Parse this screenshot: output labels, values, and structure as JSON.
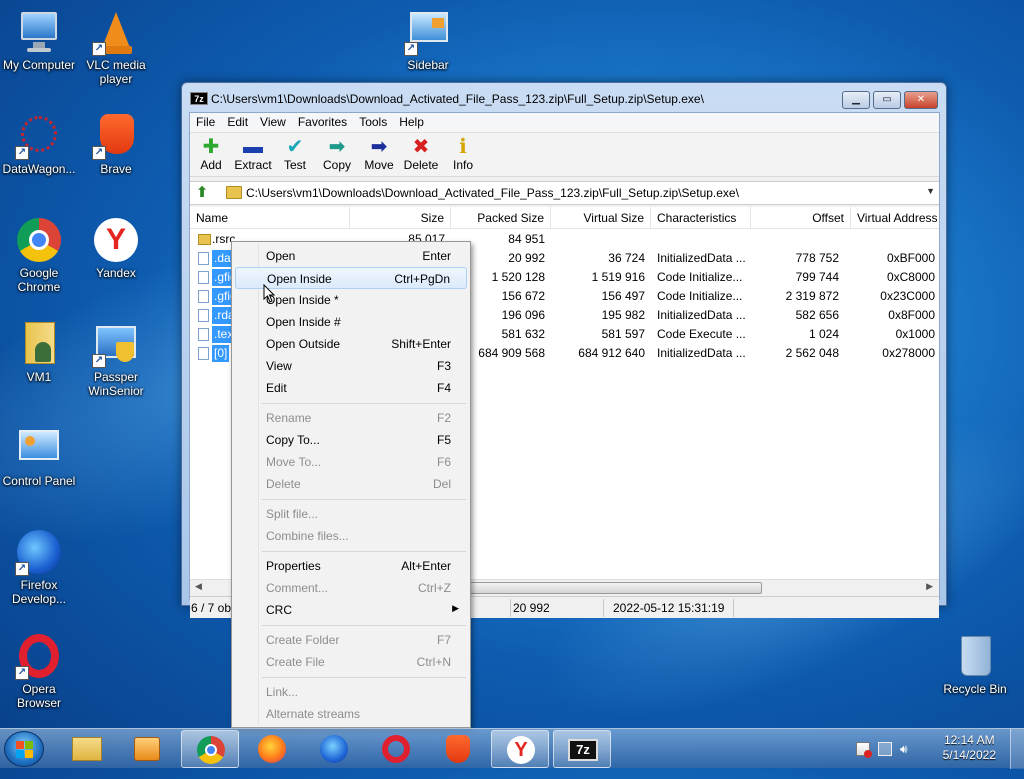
{
  "desktop": {
    "icons": [
      {
        "label": "My Computer"
      },
      {
        "label": "VLC media player"
      },
      {
        "label": "Sidebar"
      },
      {
        "label": "DataWagon..."
      },
      {
        "label": "Brave"
      },
      {
        "label": "Google Chrome"
      },
      {
        "label": "Yandex"
      },
      {
        "label": "VM1"
      },
      {
        "label": "Passper WinSenior"
      },
      {
        "label": "Control Panel"
      },
      {
        "label": "Firefox Develop..."
      },
      {
        "label": "Opera Browser"
      },
      {
        "label": "Recycle Bin"
      }
    ]
  },
  "window": {
    "title": "C:\\Users\\vm1\\Downloads\\Download_Activated_File_Pass_123.zip\\Full_Setup.zip\\Setup.exe\\",
    "app_icon": "7z",
    "menu": [
      "File",
      "Edit",
      "View",
      "Favorites",
      "Tools",
      "Help"
    ],
    "toolbar": [
      {
        "label": "Add",
        "icon": "plus-icon",
        "color": "#2ea82e"
      },
      {
        "label": "Extract",
        "icon": "minus-icon",
        "color": "#1c3fb0"
      },
      {
        "label": "Test",
        "icon": "check-icon",
        "color": "#1aa7b8"
      },
      {
        "label": "Copy",
        "icon": "arrow-right-icon",
        "color": "#1d9a8a"
      },
      {
        "label": "Move",
        "icon": "arrow-right-icon",
        "color": "#1c2f9a"
      },
      {
        "label": "Delete",
        "icon": "x-icon",
        "color": "#d61f1f"
      },
      {
        "label": "Info",
        "icon": "info-icon",
        "color": "#d4a400"
      }
    ],
    "address": "C:\\Users\\vm1\\Downloads\\Download_Activated_File_Pass_123.zip\\Full_Setup.zip\\Setup.exe\\",
    "columns": [
      "Name",
      "Size",
      "Packed Size",
      "Virtual Size",
      "Characteristics",
      "Offset",
      "Virtual Address"
    ],
    "rows": [
      {
        "name": ".rsrc",
        "size": "85 017",
        "packed": "84 951",
        "vsize": "",
        "chars": "",
        "offset": "",
        "vaddr": "",
        "type": "folder",
        "selected": false
      },
      {
        "name": ".data",
        "size": "",
        "packed": "20 992",
        "vsize": "36 724",
        "chars": "InitializedData ...",
        "offset": "778 752",
        "vaddr": "0xBF000",
        "type": "file",
        "selected": true
      },
      {
        "name": ".gfids",
        "size": "",
        "packed": "1 520 128",
        "vsize": "1 519 916",
        "chars": "Code Initialize...",
        "offset": "799 744",
        "vaddr": "0xC8000",
        "type": "file",
        "selected": true
      },
      {
        "name": ".gfids",
        "size": "",
        "packed": "156 672",
        "vsize": "156 497",
        "chars": "Code Initialize...",
        "offset": "2 319 872",
        "vaddr": "0x23C000",
        "type": "file",
        "selected": true
      },
      {
        "name": ".rdata",
        "size": "",
        "packed": "196 096",
        "vsize": "195 982",
        "chars": "InitializedData ...",
        "offset": "582 656",
        "vaddr": "0x8F000",
        "type": "file",
        "selected": true
      },
      {
        "name": ".text",
        "size": "",
        "packed": "581 632",
        "vsize": "581 597",
        "chars": "Code Execute ...",
        "offset": "1 024",
        "vaddr": "0x1000",
        "type": "file",
        "selected": true
      },
      {
        "name": "[0]",
        "size": "",
        "packed": "684 909 568",
        "vsize": "684 912 640",
        "chars": "InitializedData ...",
        "offset": "2 562 048",
        "vaddr": "0x278000",
        "type": "file",
        "selected": true
      }
    ],
    "status": {
      "count": "6 / 7 obj",
      "size": "20 992",
      "date": "2022-05-12 15:31:19"
    }
  },
  "context_menu": {
    "items": [
      {
        "label": "Open",
        "shortcut": "Enter",
        "disabled": false
      },
      {
        "label": "Open Inside",
        "shortcut": "Ctrl+PgDn",
        "disabled": false,
        "highlighted": true
      },
      {
        "label": "Open Inside *",
        "shortcut": "",
        "disabled": false
      },
      {
        "label": "Open Inside #",
        "shortcut": "",
        "disabled": false
      },
      {
        "label": "Open Outside",
        "shortcut": "Shift+Enter",
        "disabled": false
      },
      {
        "label": "View",
        "shortcut": "F3",
        "disabled": false
      },
      {
        "label": "Edit",
        "shortcut": "F4",
        "disabled": false
      },
      {
        "separator": true
      },
      {
        "label": "Rename",
        "shortcut": "F2",
        "disabled": true
      },
      {
        "label": "Copy To...",
        "shortcut": "F5",
        "disabled": false
      },
      {
        "label": "Move To...",
        "shortcut": "F6",
        "disabled": true
      },
      {
        "label": "Delete",
        "shortcut": "Del",
        "disabled": true
      },
      {
        "separator": true
      },
      {
        "label": "Split file...",
        "shortcut": "",
        "disabled": true
      },
      {
        "label": "Combine files...",
        "shortcut": "",
        "disabled": true
      },
      {
        "separator": true
      },
      {
        "label": "Properties",
        "shortcut": "Alt+Enter",
        "disabled": false
      },
      {
        "label": "Comment...",
        "shortcut": "Ctrl+Z",
        "disabled": true
      },
      {
        "label": "CRC",
        "shortcut": "",
        "disabled": false,
        "submenu": true
      },
      {
        "separator": true
      },
      {
        "label": "Create Folder",
        "shortcut": "F7",
        "disabled": true
      },
      {
        "label": "Create File",
        "shortcut": "Ctrl+N",
        "disabled": true
      },
      {
        "separator": true
      },
      {
        "label": "Link...",
        "shortcut": "",
        "disabled": true
      },
      {
        "label": "Alternate streams",
        "shortcut": "",
        "disabled": true
      }
    ]
  },
  "taskbar": {
    "apps": [
      {
        "name": "Windows Explorer",
        "icon": "folder-icon"
      },
      {
        "name": "Windows Media Player",
        "icon": "media-player-icon"
      },
      {
        "name": "Google Chrome",
        "icon": "chrome-icon"
      },
      {
        "name": "Firefox",
        "icon": "firefox-icon"
      },
      {
        "name": "Firefox Developer",
        "icon": "firefox-dev-icon"
      },
      {
        "name": "Opera",
        "icon": "opera-icon"
      },
      {
        "name": "Brave",
        "icon": "brave-icon"
      },
      {
        "name": "Yandex",
        "icon": "yandex-icon"
      },
      {
        "name": "7-Zip",
        "icon": "7zip-icon",
        "label": "7z"
      }
    ],
    "clock": {
      "time": "12:14 AM",
      "date": "5/14/2022"
    }
  }
}
